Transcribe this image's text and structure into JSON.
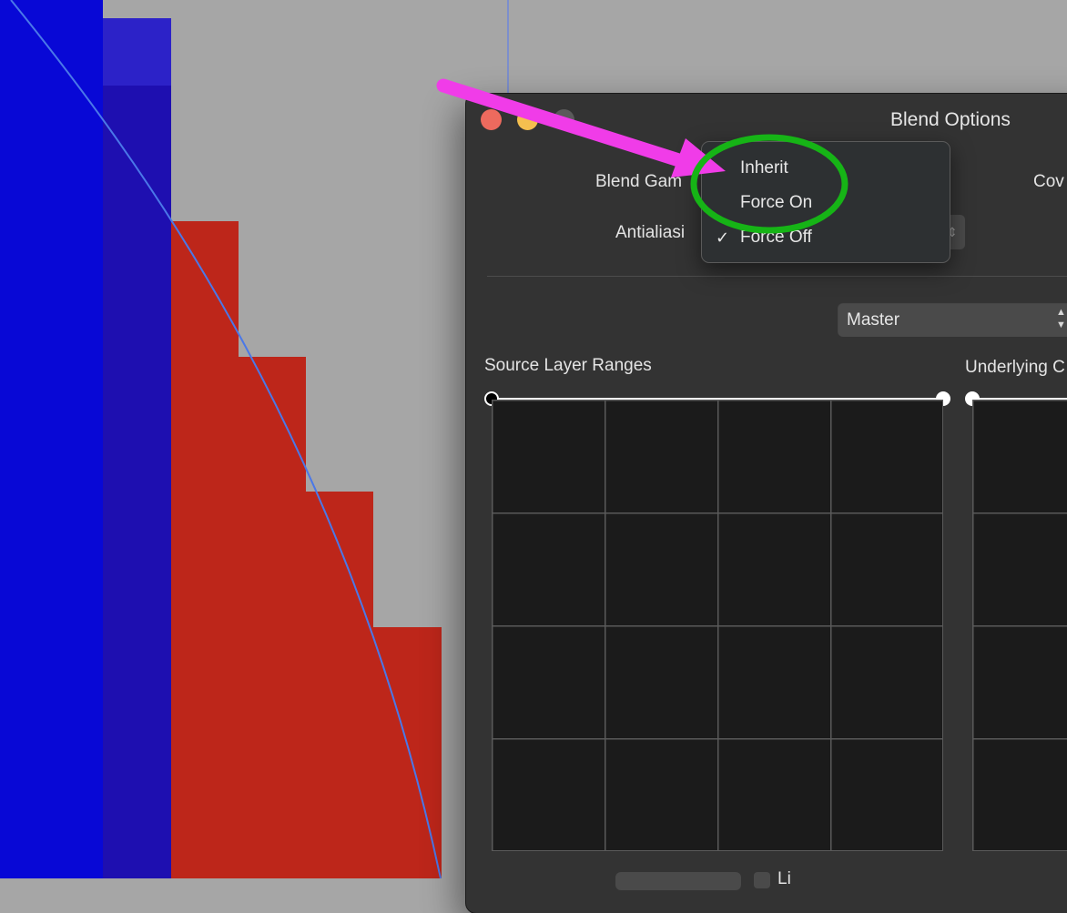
{
  "dialog": {
    "title": "Blend Options",
    "blend_gamma_label": "Blend Gam",
    "antialiasing_label": "Antialiasi",
    "coverage_label": "Cov",
    "channel_select": {
      "value": "Master"
    },
    "source_ranges_label": "Source Layer Ranges",
    "underlying_ranges_label": "Underlying C",
    "bottom_text": "Li"
  },
  "menu": {
    "items": [
      {
        "label": "Inherit",
        "checked": false
      },
      {
        "label": "Force On",
        "checked": false
      },
      {
        "label": "Force Off",
        "checked": true
      }
    ],
    "check_glyph": "✓"
  },
  "colors": {
    "canvas": "#a6a6a6",
    "blue": "#0808d6",
    "red": "#bd261a",
    "dialog": "#333333",
    "annotation_arrow": "#f03ce8",
    "annotation_circle": "#16b416",
    "curve": "#4a78e8"
  },
  "icons": {
    "close": "close-icon",
    "minimize": "minimize-icon",
    "zoom": "zoom-icon",
    "stepper": "stepper-arrows-icon",
    "checkmark": "checkmark-icon"
  }
}
